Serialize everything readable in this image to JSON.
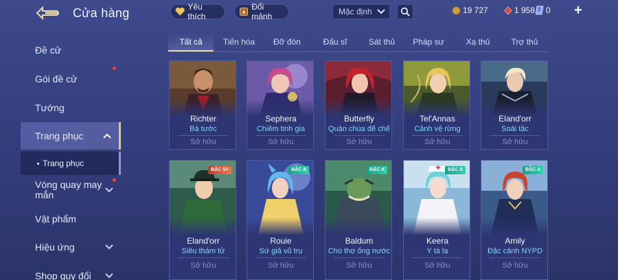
{
  "header": {
    "title": "Cửa hàng",
    "favorites_label": "Yêu thích",
    "trade_label": "Đổi mảnh",
    "sort_value": "Mặc định",
    "gold": "19 727",
    "red_currency": "1 958",
    "voucher": "0",
    "add_symbol": "+"
  },
  "sidebar": {
    "items": [
      {
        "label": "Đề cử"
      },
      {
        "label": "Gói đề cử"
      },
      {
        "label": "Tướng"
      },
      {
        "label": "Trang phục"
      },
      {
        "label": "Vòng quay may mắn"
      },
      {
        "label": "Vật phẩm"
      },
      {
        "label": "Hiệu ứng"
      },
      {
        "label": "Shop quy đổi"
      }
    ],
    "sub_item": "Trang phục"
  },
  "tabs": [
    {
      "label": "Tất cả"
    },
    {
      "label": "Tiến hóa"
    },
    {
      "label": "Đỡ đòn"
    },
    {
      "label": "Đấu sĩ"
    },
    {
      "label": "Sát thủ"
    },
    {
      "label": "Pháp sư"
    },
    {
      "label": "Xạ thủ"
    },
    {
      "label": "Trợ thủ"
    }
  ],
  "cards": [
    {
      "hero": "Richter",
      "skin": "Bá tước",
      "status": "Sở hữu",
      "badge": ""
    },
    {
      "hero": "Sephera",
      "skin": "Chiêm tinh gia",
      "status": "Sở hữu",
      "badge": ""
    },
    {
      "hero": "Butterfly",
      "skin": "Quận chúa đế chế",
      "status": "Sở hữu",
      "badge": ""
    },
    {
      "hero": "Tel'Annas",
      "skin": "Cảnh vệ rừng",
      "status": "Sở hữu",
      "badge": ""
    },
    {
      "hero": "Eland'orr",
      "skin": "Soái tặc",
      "status": "Sở hữu",
      "badge": ""
    },
    {
      "hero": "Eland'orr",
      "skin": "Siêu thám tử",
      "status": "Sở hữu",
      "badge": "BẬC S+"
    },
    {
      "hero": "Rouie",
      "skin": "Sứ giả vũ trụ",
      "status": "Sở hữu",
      "badge": "BẬC A"
    },
    {
      "hero": "Baldum",
      "skin": "Chú thợ ống nước",
      "status": "Sở hữu",
      "badge": "BẬC A"
    },
    {
      "hero": "Keera",
      "skin": "Y tá lạ",
      "status": "Sở hữu",
      "badge": "BẬC A"
    },
    {
      "hero": "Amily",
      "skin": "Đặc cảnh NYPD",
      "status": "Sở hữu",
      "badge": "BẬC A"
    }
  ],
  "colors": {
    "accent_gold": "#e3c777",
    "skin_name": "#7fd9ff",
    "notification": "#ff3b3b"
  },
  "icons": {
    "back": "back-arrow-icon",
    "favorites": "heart-icon",
    "trade": "shards-icon",
    "sort": "chevron-down-icon",
    "search": "search-icon",
    "gold": "gold-coin-icon",
    "red": "red-diamond-icon",
    "voucher": "voucher-icon"
  }
}
